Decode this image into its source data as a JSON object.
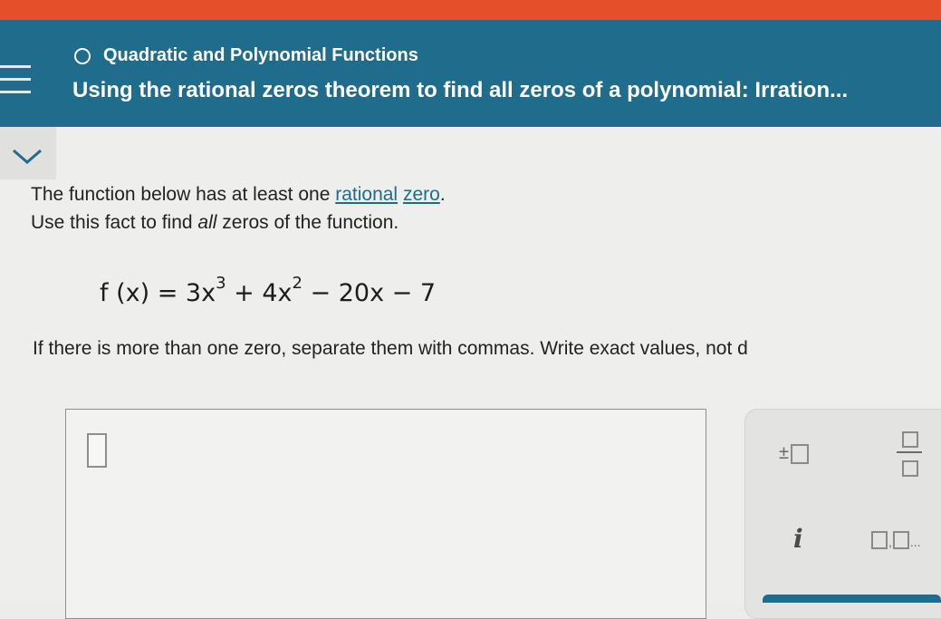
{
  "header": {
    "topic_title": "Quadratic and Polynomial Functions",
    "lesson_title": "Using the rational zeros theorem to find all zeros of a polynomial: Irration..."
  },
  "problem": {
    "line1_before": "The function below has at least one ",
    "link1": "rational",
    "space": " ",
    "link2": "zero",
    "line1_after": ".",
    "line2": "Use this fact to find all zeros of the function.",
    "line2_before": "Use this fact to find ",
    "line2_emph": "all",
    "line2_after": " zeros of the function.",
    "equation": {
      "lhs": "f (x) = 3x",
      "exp1": "3",
      "mid": " + 4x",
      "exp2": "2",
      "rhs": " − 20x − 7"
    },
    "note": "If there is more than one zero, separate them with commas. Write exact values, not d"
  },
  "keypad": {
    "plus_minus_label": "±",
    "imaginary_label": "i",
    "list_separator": ",",
    "list_trailing": "..."
  },
  "colors": {
    "header_bg": "#1f6c8c",
    "top_strip": "#e5502b",
    "link": "#1d6c8a"
  },
  "icons": [
    "menu-icon",
    "status-circle-icon",
    "chevron-down-icon",
    "plus-minus-box-icon",
    "fraction-icon",
    "imaginary-i-icon",
    "list-icon"
  ]
}
